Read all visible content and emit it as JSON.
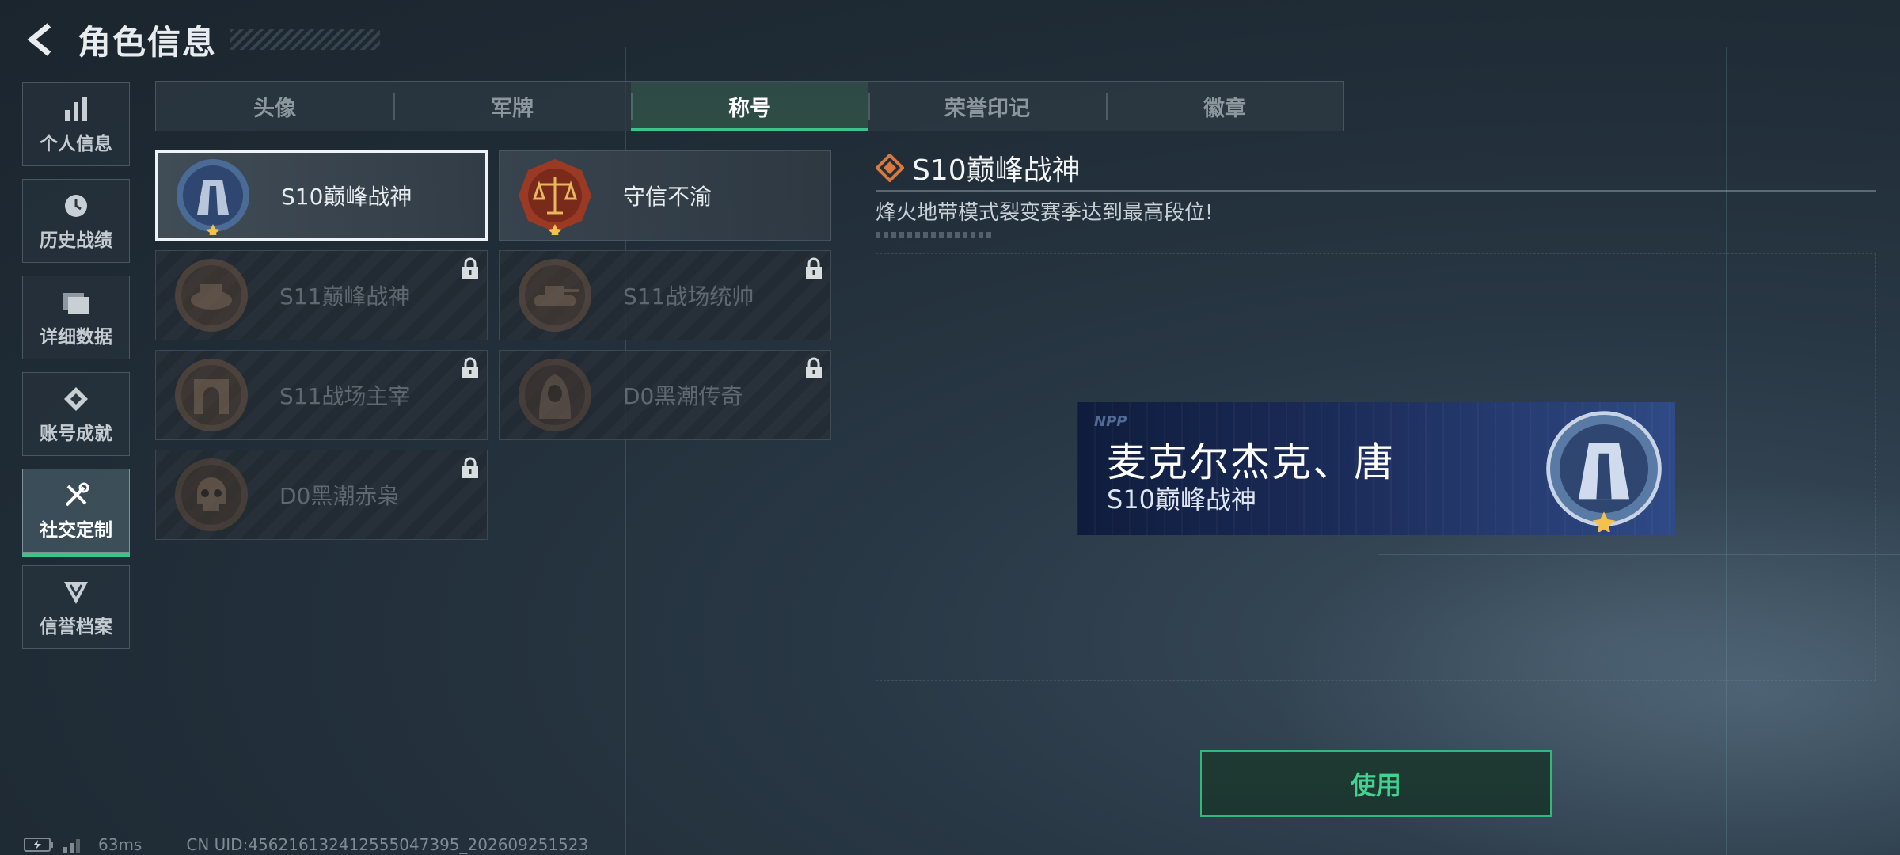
{
  "header": {
    "title": "角色信息"
  },
  "sidebar": {
    "items": [
      {
        "label": "个人信息",
        "icon": "bar-chart-icon",
        "active": false
      },
      {
        "label": "历史战绩",
        "icon": "clock-icon",
        "active": false
      },
      {
        "label": "详细数据",
        "icon": "folder-icon",
        "active": false
      },
      {
        "label": "账号成就",
        "icon": "achievement-icon",
        "active": false
      },
      {
        "label": "社交定制",
        "icon": "tools-icon",
        "active": true
      },
      {
        "label": "信誉档案",
        "icon": "shield-rank-icon",
        "active": false
      }
    ]
  },
  "tabs": [
    {
      "label": "头像",
      "active": false
    },
    {
      "label": "军牌",
      "active": false
    },
    {
      "label": "称号",
      "active": true
    },
    {
      "label": "荣誉印记",
      "active": false
    },
    {
      "label": "徽章",
      "active": false
    }
  ],
  "titles": [
    {
      "name": "S10巅峰战神",
      "state": "selected",
      "emblem": "peak-warrior-emblem-icon"
    },
    {
      "name": "守信不渝",
      "state": "unlocked",
      "emblem": "scales-emblem-icon"
    },
    {
      "name": "S11巅峰战神",
      "state": "locked",
      "emblem": "vehicle-emblem-icon"
    },
    {
      "name": "S11战场统帅",
      "state": "locked",
      "emblem": "tank-emblem-icon"
    },
    {
      "name": "S11战场主宰",
      "state": "locked",
      "emblem": "arch-emblem-icon"
    },
    {
      "name": "D0黑潮传奇",
      "state": "locked",
      "emblem": "hooded-figure-emblem-icon"
    },
    {
      "name": "D0黑潮赤枭",
      "state": "locked",
      "emblem": "skull-emblem-icon"
    }
  ],
  "detail": {
    "title": "S10巅峰战神",
    "description": "烽火地带模式裂变赛季达到最高段位!"
  },
  "preview": {
    "player_name": "麦克尔杰克、唐",
    "title": "S10巅峰战神"
  },
  "actions": {
    "use_label": "使用"
  },
  "status": {
    "ping": "63ms",
    "uid": "CN UID:456216132412555047395_202609251523"
  },
  "colors": {
    "accent": "#39c58a",
    "banner": "#1c2c5a",
    "diamond": "#d9783f"
  }
}
